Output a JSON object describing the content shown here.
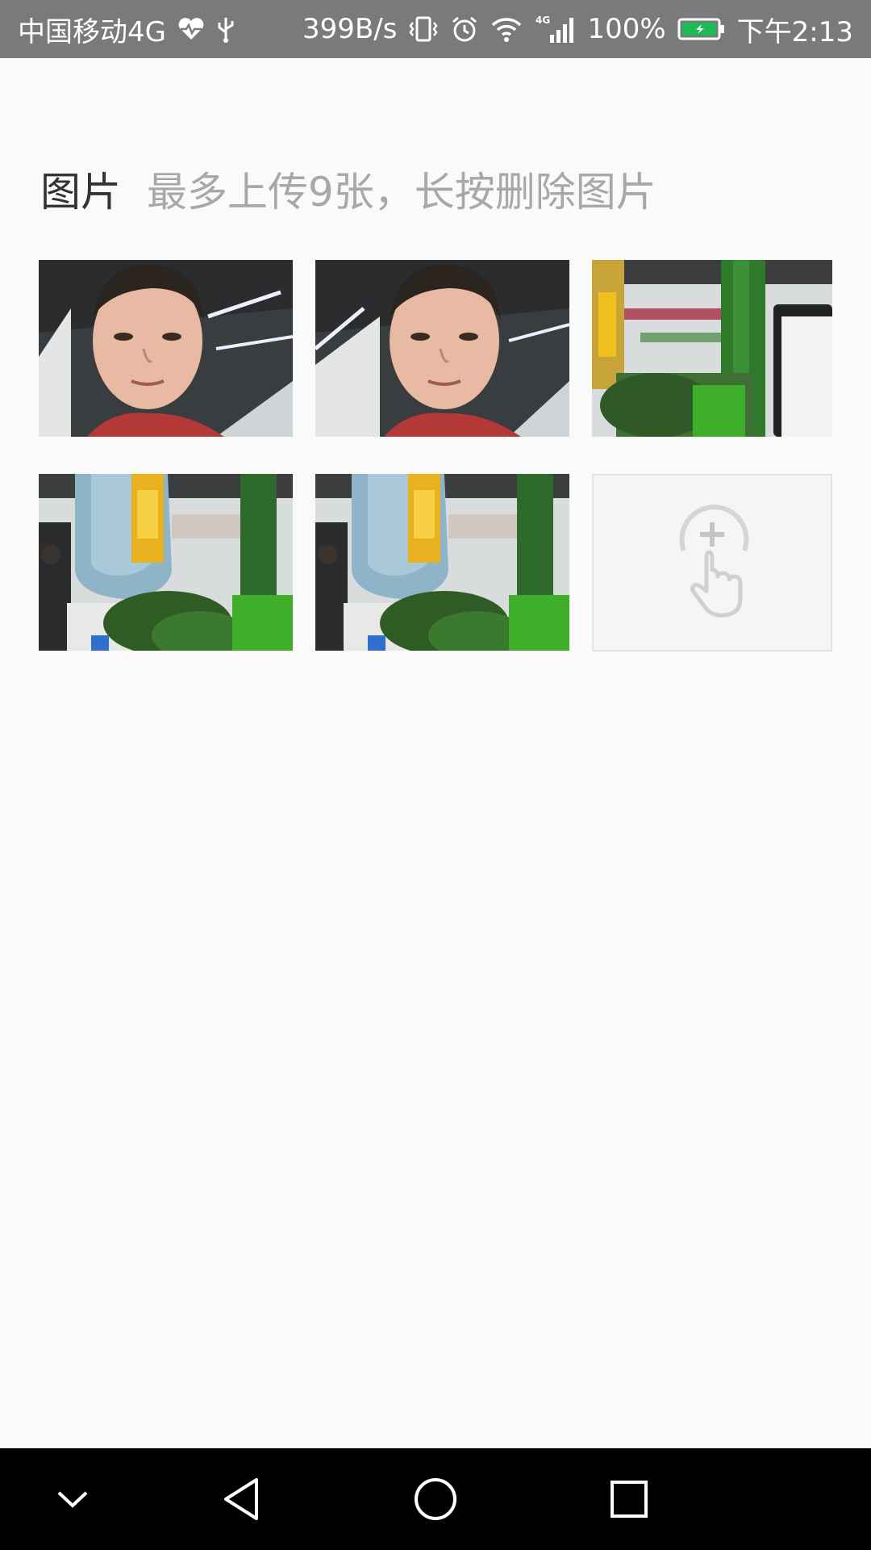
{
  "status_bar": {
    "carrier": "中国移动4G",
    "speed": "399B/s",
    "network_label": "4G",
    "battery": "100%",
    "time": "下午2:13",
    "icons": [
      "heart-icon",
      "usb-icon",
      "vibrate-icon",
      "alarm-icon",
      "wifi-icon",
      "signal-icon",
      "battery-icon"
    ]
  },
  "section": {
    "title": "图片",
    "hint": "最多上传9张，长按删除图片"
  },
  "photos": [
    {
      "subject": "selfie-man"
    },
    {
      "subject": "selfie-man"
    },
    {
      "subject": "office-glass-wall"
    },
    {
      "subject": "water-dispenser"
    },
    {
      "subject": "water-dispenser"
    }
  ],
  "add_tile": {
    "icon": "add-photo-tap-icon"
  },
  "nav_bar": {
    "icons": [
      "collapse-chevron-icon",
      "back-icon",
      "home-icon",
      "recents-icon"
    ]
  },
  "colors": {
    "status_bar_bg": "#7a7a7a",
    "page_bg": "#fafafa",
    "title_text": "#333333",
    "hint_text": "#a8a8a8",
    "battery_fill": "#1db954",
    "nav_bg": "#000000"
  }
}
